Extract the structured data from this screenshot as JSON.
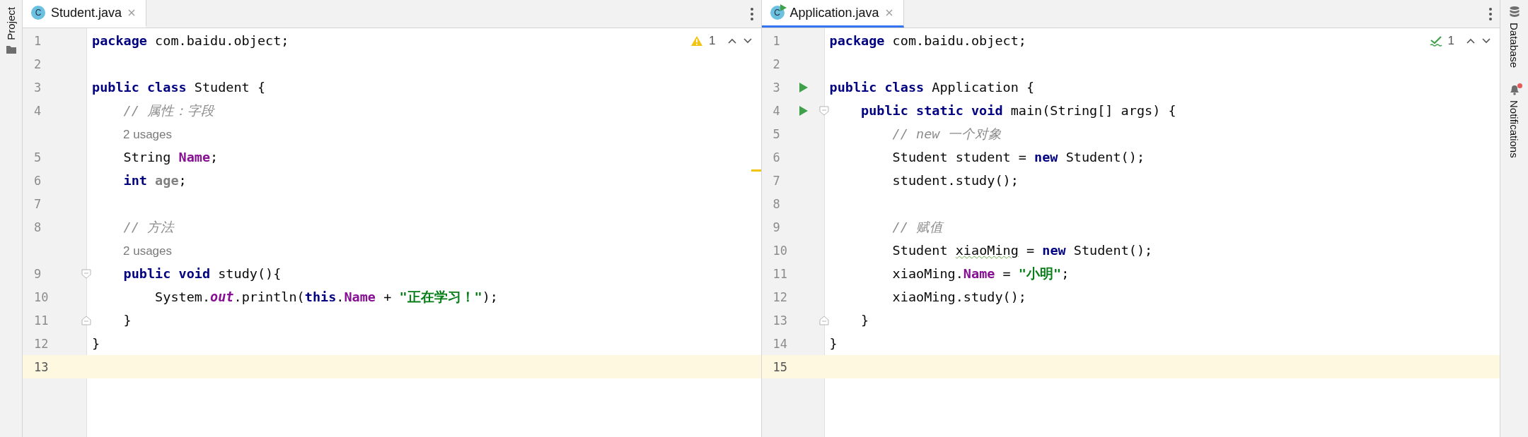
{
  "left_strip": {
    "label": "Project"
  },
  "right_strip": {
    "items": [
      {
        "kind": "database",
        "label": "Database"
      },
      {
        "kind": "notifications",
        "label": "Notifications",
        "unread": true
      }
    ]
  },
  "panes": [
    {
      "focused": false,
      "tab": {
        "label": "Student.java",
        "icon_letter": "C",
        "runnable": false,
        "selected": true
      },
      "inspection": {
        "kind": "warning",
        "count": "1"
      },
      "warning_stripe": true,
      "lines": [
        {
          "kind": "code",
          "n": "1",
          "current": false,
          "tokens": [
            {
              "kind": "kw",
              "s": "package"
            },
            {
              "kind": "plain",
              "s": " com.baidu.object;"
            }
          ]
        },
        {
          "kind": "code",
          "n": "2",
          "current": false
        },
        {
          "kind": "code",
          "n": "3",
          "current": false,
          "tokens": [
            {
              "kind": "kw",
              "s": "public class"
            },
            {
              "kind": "plain",
              "s": " Student {"
            }
          ]
        },
        {
          "kind": "code",
          "n": "4",
          "current": false,
          "tokens": [
            {
              "kind": "comment",
              "s": "    // 属性：字段"
            }
          ]
        },
        {
          "kind": "hint",
          "text": "2 usages"
        },
        {
          "kind": "code",
          "n": "5",
          "current": false,
          "tokens": [
            {
              "kind": "plain",
              "s": "    String "
            },
            {
              "kind": "field",
              "s": "Name"
            },
            {
              "kind": "plain",
              "s": ";"
            }
          ]
        },
        {
          "kind": "code",
          "n": "6",
          "current": false,
          "tokens": [
            {
              "kind": "kw",
              "s": "    int"
            },
            {
              "kind": "unused",
              "s": " age"
            },
            {
              "kind": "plain",
              "s": ";"
            }
          ]
        },
        {
          "kind": "code",
          "n": "7",
          "current": false
        },
        {
          "kind": "code",
          "n": "8",
          "current": false,
          "tokens": [
            {
              "kind": "comment",
              "s": "    // 方法"
            }
          ]
        },
        {
          "kind": "hint",
          "text": "2 usages"
        },
        {
          "kind": "code",
          "n": "9",
          "current": false,
          "fold_start": true,
          "tokens": [
            {
              "kind": "kw",
              "s": "    public void"
            },
            {
              "kind": "plain",
              "s": " study(){"
            }
          ]
        },
        {
          "kind": "code",
          "n": "10",
          "current": false,
          "tokens": [
            {
              "kind": "plain",
              "s": "        System."
            },
            {
              "kind": "static",
              "s": "out"
            },
            {
              "kind": "plain",
              "s": ".println("
            },
            {
              "kind": "kw",
              "s": "this"
            },
            {
              "kind": "plain",
              "s": "."
            },
            {
              "kind": "field",
              "s": "Name"
            },
            {
              "kind": "plain",
              "s": " + "
            },
            {
              "kind": "string",
              "s": "\"正在学习！\""
            },
            {
              "kind": "plain",
              "s": ");"
            }
          ]
        },
        {
          "kind": "code",
          "n": "11",
          "current": false,
          "fold_end": true,
          "tokens": [
            {
              "kind": "plain",
              "s": "    }"
            }
          ]
        },
        {
          "kind": "code",
          "n": "12",
          "current": false,
          "tokens": [
            {
              "kind": "plain",
              "s": "}"
            }
          ]
        },
        {
          "kind": "code",
          "n": "13",
          "current": true
        }
      ]
    },
    {
      "focused": true,
      "tab": {
        "label": "Application.java",
        "icon_letter": "C",
        "runnable": true,
        "selected": true
      },
      "inspection": {
        "kind": "ok",
        "count": "1"
      },
      "lines": [
        {
          "kind": "code",
          "n": "1",
          "current": false,
          "tokens": [
            {
              "kind": "kw",
              "s": "package"
            },
            {
              "kind": "plain",
              "s": " com.baidu.object;"
            }
          ]
        },
        {
          "kind": "code",
          "n": "2",
          "current": false
        },
        {
          "kind": "code",
          "n": "3",
          "current": false,
          "run": true,
          "tokens": [
            {
              "kind": "kw",
              "s": "public class"
            },
            {
              "kind": "plain",
              "s": " Application {"
            }
          ]
        },
        {
          "kind": "code",
          "n": "4",
          "current": false,
          "run": true,
          "fold_start": true,
          "tokens": [
            {
              "kind": "kw",
              "s": "    public static void"
            },
            {
              "kind": "plain",
              "s": " main(String[] args) {"
            }
          ]
        },
        {
          "kind": "code",
          "n": "5",
          "current": false,
          "tokens": [
            {
              "kind": "comment",
              "s": "        // new 一个对象"
            }
          ]
        },
        {
          "kind": "code",
          "n": "6",
          "current": false,
          "tokens": [
            {
              "kind": "plain",
              "s": "        Student student = "
            },
            {
              "kind": "kw",
              "s": "new"
            },
            {
              "kind": "plain",
              "s": " Student();"
            }
          ]
        },
        {
          "kind": "code",
          "n": "7",
          "current": false,
          "tokens": [
            {
              "kind": "plain",
              "s": "        student.study();"
            }
          ]
        },
        {
          "kind": "code",
          "n": "8",
          "current": false
        },
        {
          "kind": "code",
          "n": "9",
          "current": false,
          "tokens": [
            {
              "kind": "comment",
              "s": "        // 赋值"
            }
          ]
        },
        {
          "kind": "code",
          "n": "10",
          "current": false,
          "tokens": [
            {
              "kind": "plain",
              "s": "        Student "
            },
            {
              "kind": "typo",
              "s": "xiaoMing"
            },
            {
              "kind": "plain",
              "s": " = "
            },
            {
              "kind": "kw",
              "s": "new"
            },
            {
              "kind": "plain",
              "s": " Student();"
            }
          ]
        },
        {
          "kind": "code",
          "n": "11",
          "current": false,
          "tokens": [
            {
              "kind": "plain",
              "s": "        xiaoMing."
            },
            {
              "kind": "field",
              "s": "Name"
            },
            {
              "kind": "plain",
              "s": " = "
            },
            {
              "kind": "string",
              "s": "\"小明\""
            },
            {
              "kind": "plain",
              "s": ";"
            }
          ]
        },
        {
          "kind": "code",
          "n": "12",
          "current": false,
          "tokens": [
            {
              "kind": "plain",
              "s": "        xiaoMing.study();"
            }
          ]
        },
        {
          "kind": "code",
          "n": "13",
          "current": false,
          "fold_end": true,
          "tokens": [
            {
              "kind": "plain",
              "s": "    }"
            }
          ]
        },
        {
          "kind": "code",
          "n": "14",
          "current": false,
          "tokens": [
            {
              "kind": "plain",
              "s": "}"
            }
          ]
        },
        {
          "kind": "code",
          "n": "15",
          "current": true
        }
      ]
    }
  ]
}
